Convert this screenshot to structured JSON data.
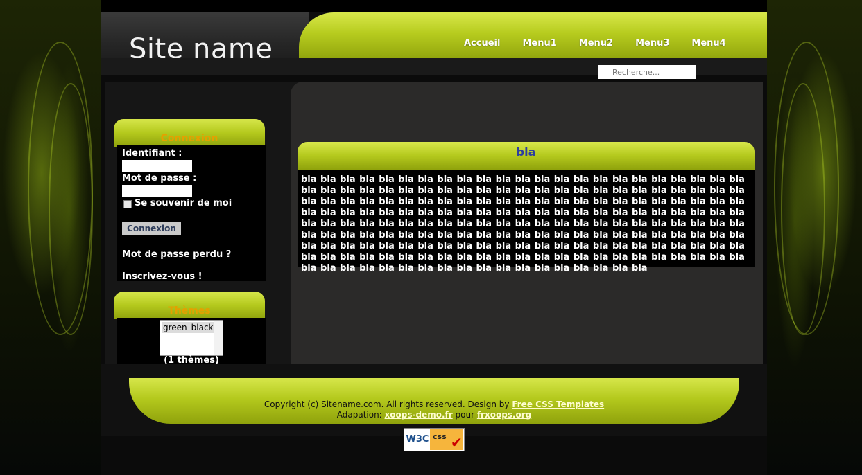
{
  "header": {
    "site_name": "Site name",
    "nav": [
      "Accueil",
      "Menu1",
      "Menu2",
      "Menu3",
      "Menu4"
    ],
    "search_placeholder": "Recherche..."
  },
  "sidebar": {
    "login": {
      "title": "Connexion",
      "username_label": "Identifiant :",
      "password_label": "Mot de passe :",
      "remember_label": "Se souvenir de moi",
      "submit_label": "Connexion",
      "lost_password": "Mot de passe perdu ?",
      "register": "Inscrivez-vous !"
    },
    "themes": {
      "title": "Thèmes",
      "options": [
        "green_black"
      ],
      "count_label": "(1 thèmes)"
    }
  },
  "content": {
    "title": "bla",
    "body": "bla bla bla bla bla bla bla bla bla bla bla bla bla bla bla bla bla bla bla bla bla bla bla bla bla bla bla bla bla bla bla bla bla bla bla bla bla bla bla bla bla bla bla bla bla bla bla bla bla bla bla bla bla bla bla bla bla bla bla bla bla bla bla bla bla bla bla bla bla bla bla bla bla bla bla bla bla bla bla bla bla bla bla bla bla bla bla bla bla bla bla bla bla bla bla bla bla bla bla bla bla bla bla bla bla bla bla bla bla bla bla bla bla bla bla bla bla bla bla bla bla bla bla bla bla bla bla bla bla bla bla bla bla bla bla bla bla bla bla bla bla bla bla bla bla bla bla bla bla bla bla bla bla bla bla bla bla bla bla bla bla bla bla bla bla bla bla bla bla bla bla bla bla bla bla bla bla bla bla bla bla bla bla bla bla bla bla bla bla bla bla bla bla bla bla bla bla bla bla bla bla bla"
  },
  "footer": {
    "copyright_prefix": "Copyright (c) Sitename.com. All rights reserved. Design by",
    "design_link": "Free CSS Templates",
    "adaptation_prefix": "Adapation:",
    "adaptation_link": "xoops-demo.fr",
    "adaptation_mid": "pour",
    "adaptation_link2": "frxoops.org",
    "badge_w3c": "W3C",
    "badge_css": "css"
  },
  "colors": {
    "accent": "#b4c91d",
    "block_title_text": "#e4a000",
    "content_title_text": "#2d3fa0"
  }
}
